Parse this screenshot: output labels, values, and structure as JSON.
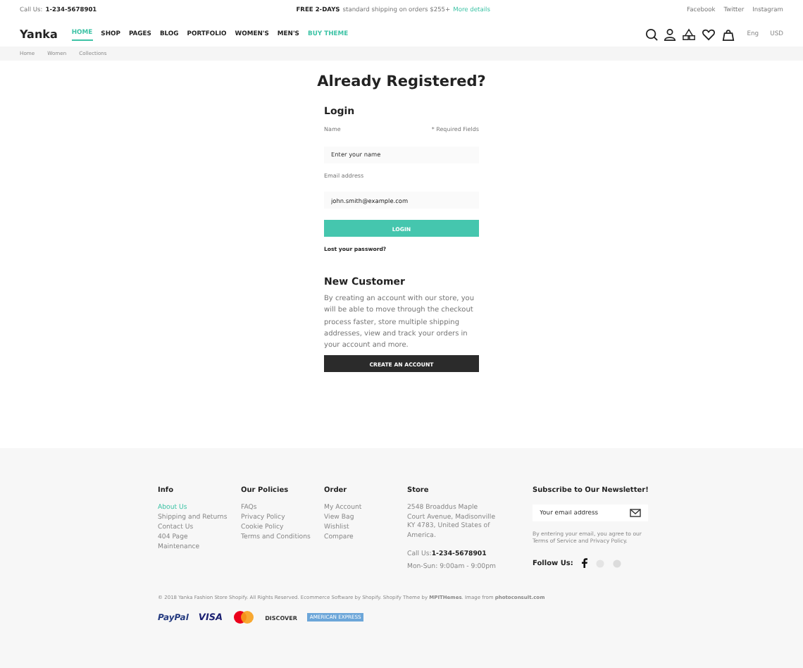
{
  "topbar": {
    "call_label": "Call Us:",
    "phone": "1-234-5678901",
    "promo_bold": "FREE 2-DAYS",
    "promo_text": "standard shipping on orders $255+",
    "promo_link": "More details",
    "social": [
      "Facebook",
      "Twitter",
      "Instagram"
    ]
  },
  "nav": {
    "logo": "Yanka",
    "items": [
      {
        "label": "HOME",
        "selected": true,
        "kind": "normal"
      },
      {
        "label": "SHOP",
        "selected": false,
        "kind": "normal"
      },
      {
        "label": "PAGES",
        "selected": false,
        "kind": "normal"
      },
      {
        "label": "BLOG",
        "selected": false,
        "kind": "normal"
      },
      {
        "label": "PORTFOLIO",
        "selected": false,
        "kind": "normal"
      },
      {
        "label": "WOMEN'S",
        "selected": false,
        "kind": "normal"
      },
      {
        "label": "MEN'S",
        "selected": false,
        "kind": "normal"
      },
      {
        "label": "BUY THEME",
        "selected": false,
        "kind": "accent"
      }
    ],
    "language": "Eng",
    "currency": "USD"
  },
  "breadcrumb": [
    "Home",
    "Women",
    "Collections"
  ],
  "login": {
    "title": "Already Registered?",
    "heading": "Login",
    "required_note": "* Required Fields",
    "fields": [
      {
        "label": "Name",
        "placeholder": "Enter your name"
      },
      {
        "label": "Email address",
        "value": "john.smith@example.com"
      }
    ],
    "button": "LOGIN",
    "lost_password": "Lost your password?"
  },
  "new_customer": {
    "heading": "New Customer",
    "text": "By creating an account with our store, you will be able to move through the checkout process faster, store multiple shipping addresses, view and track your orders in your account and more.",
    "button": "CREATE AN ACCOUNT"
  },
  "footer": {
    "columns": [
      {
        "title": "Info",
        "links": [
          {
            "label": "About Us",
            "selected": true
          },
          {
            "label": "Shipping and Returns",
            "selected": false
          },
          {
            "label": "Contact Us",
            "selected": false
          },
          {
            "label": "404 Page",
            "selected": false
          },
          {
            "label": "Maintenance",
            "selected": false
          }
        ]
      },
      {
        "title": "Our Policies",
        "links": [
          {
            "label": "FAQs",
            "selected": false
          },
          {
            "label": "Privacy Policy",
            "selected": false
          },
          {
            "label": "Cookie Policy",
            "selected": false
          },
          {
            "label": "Terms and Conditions",
            "selected": false
          }
        ]
      },
      {
        "title": "Order",
        "links": [
          {
            "label": "My Account",
            "selected": false
          },
          {
            "label": "View Bag",
            "selected": false
          },
          {
            "label": "Wishlist",
            "selected": false
          },
          {
            "label": "Compare",
            "selected": false
          }
        ]
      }
    ],
    "store": {
      "title": "Store",
      "address": "2548 Broaddus Maple Court Avenue, Madisonville KY 4783, United States of America.",
      "call_label": "Call Us:",
      "phone": "1-234-5678901",
      "hours": "Mon-Sun: 9:00am - 9:00pm"
    },
    "newsletter": {
      "title": "Subscribe to Our Newsletter!",
      "placeholder": "Your email address",
      "note": "By entering your email, you agree to our Terms of Service and Privacy Policy.",
      "follow": "Follow Us:"
    },
    "copyright": "© 2018 Yanka Fashion Store Shopify. All Rights Reserved. Ecommerce Software by Shopify. Shopify Theme by **MPITHemes**. Image from **photoconsult.com**",
    "payments": [
      {
        "kind": "paypal",
        "label": "PayPal"
      },
      {
        "kind": "visa",
        "label": "VISA"
      },
      {
        "kind": "mastercard"
      },
      {
        "kind": "discover",
        "label": "DISCOVER"
      },
      {
        "kind": "amex",
        "label": "AMERICAN EXPRESS"
      }
    ]
  }
}
